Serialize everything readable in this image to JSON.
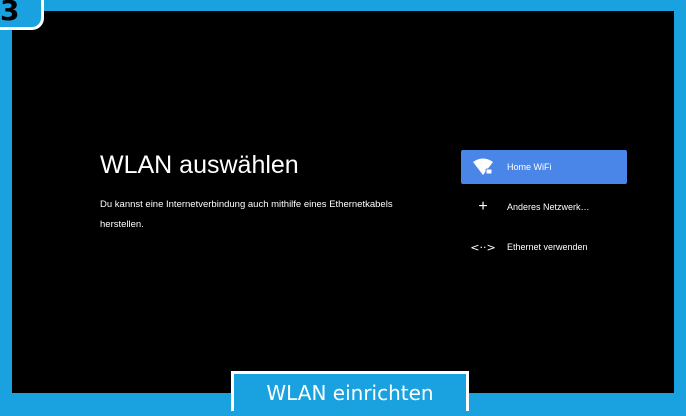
{
  "step_number": "3",
  "screen": {
    "title": "WLAN auswählen",
    "description": "Du kannst eine Internetverbindung auch mithilfe eines Ethernetkabels herstellen."
  },
  "menu": {
    "items": [
      {
        "label": "Home WiFi",
        "icon": "wifi-locked-icon",
        "selected": true
      },
      {
        "label": "Anderes Netzwerk…",
        "icon": "plus-icon",
        "selected": false
      },
      {
        "label": "Ethernet verwenden",
        "icon": "ethernet-icon",
        "selected": false
      }
    ]
  },
  "caption": "WLAN einrichten",
  "colors": {
    "accent_blue": "#1aa2e0",
    "selection_blue": "#4a86e8",
    "screen_bg": "#000000"
  }
}
